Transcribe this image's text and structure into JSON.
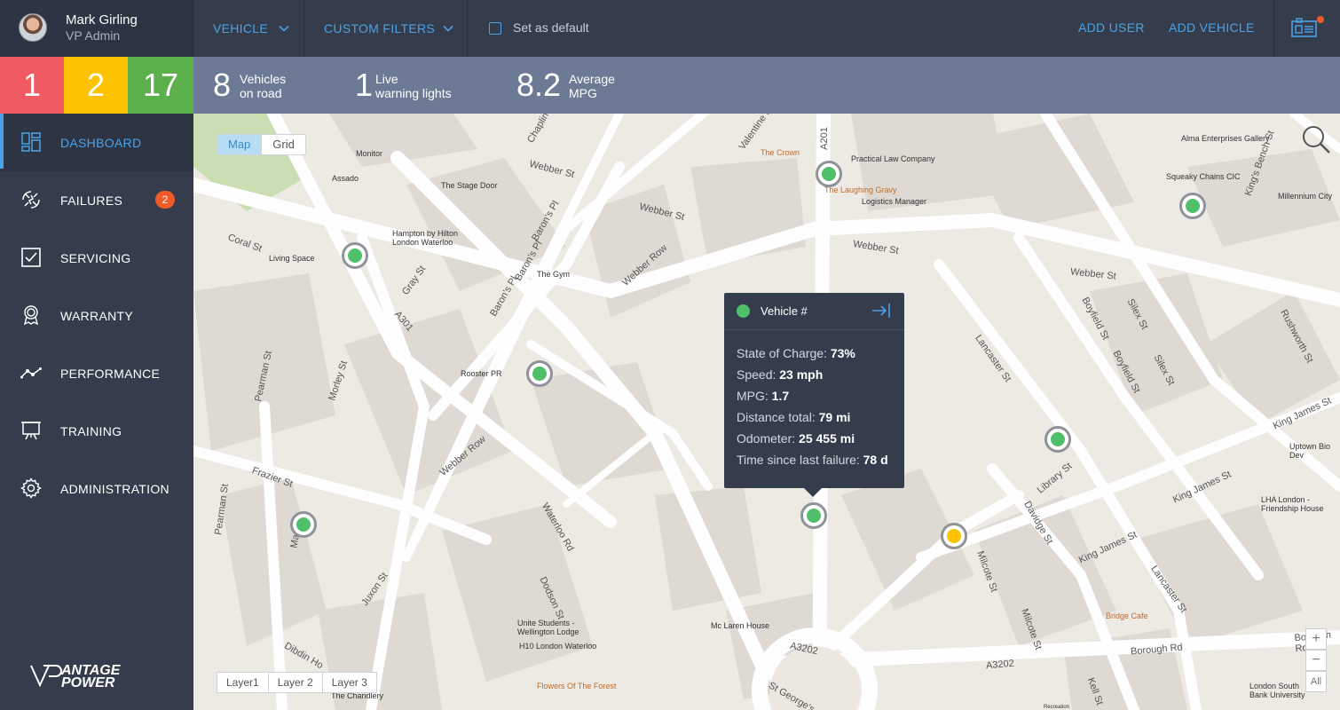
{
  "user": {
    "name": "Mark Girling",
    "role": "VP Admin"
  },
  "toolbar": {
    "vehicle_label": "VEHICLE",
    "custom_filters_label": "CUSTOM FILTERS",
    "set_default_label": "Set as default",
    "set_default_checked": false,
    "add_user_label": "ADD USER",
    "add_vehicle_label": "ADD VEHICLE",
    "notification_icon": "notifications-icon"
  },
  "alerts": {
    "red": "1",
    "yellow": "2",
    "green": "17"
  },
  "stats": [
    {
      "value": "8",
      "line1": "Vehicles",
      "line2": "on road"
    },
    {
      "value": "1",
      "line1": "Live",
      "line2": "warning lights"
    },
    {
      "value": "8.2",
      "line1": "Average",
      "line2": "MPG"
    }
  ],
  "nav": [
    {
      "label": "DASHBOARD",
      "icon": "dashboard-icon",
      "active": true
    },
    {
      "label": "FAILURES",
      "icon": "failures-icon",
      "badge": "2"
    },
    {
      "label": "SERVICING",
      "icon": "checkbox-icon"
    },
    {
      "label": "WARRANTY",
      "icon": "award-icon"
    },
    {
      "label": "PERFORMANCE",
      "icon": "line-chart-icon"
    },
    {
      "label": "TRAINING",
      "icon": "presentation-icon"
    },
    {
      "label": "ADMINISTRATION",
      "icon": "gear-icon"
    }
  ],
  "logo": {
    "text": "VANTAGE POWER"
  },
  "map": {
    "view_toggle": {
      "map": "Map",
      "grid": "Grid",
      "selected": "Map"
    },
    "layers": [
      "Layer1",
      "Layer 2",
      "Layer 3"
    ],
    "zoom": {
      "in": "+",
      "out": "−",
      "all": "All"
    },
    "streets": [
      "Webber St",
      "Webber St",
      "Webber St",
      "Webber St",
      "Webber Row",
      "Webber Row",
      "Waterloo Rd",
      "A301",
      "A201",
      "A3202",
      "A3202",
      "Borough Rd",
      "Borough Rd",
      "Library St",
      "Lancaster St",
      "Lancaster St",
      "King James St",
      "King James St",
      "King James St",
      "Boyfield St",
      "Boyfield St",
      "Silex St",
      "Silex St",
      "Rushworth St",
      "Davidge St",
      "Milcote St",
      "Milcote St",
      "Morley St",
      "Gray St",
      "Pearman St",
      "Pearman St",
      "Baron's Pl",
      "Baron's Pl",
      "Baron's Pl",
      "Coral St",
      "Frazier St",
      "Dodson St",
      "Juxon St",
      "Kell St",
      "Dibdin Ho",
      "Chaplin",
      "Valentine Pl",
      "St George's",
      "King's Bench St",
      "Ma"
    ],
    "places": [
      "Monitor",
      "Assado",
      "The Stage Door",
      "Hampton by Hilton London Waterloo",
      "Living Space",
      "The Gym",
      "Rooster PR",
      "The Crown",
      "Practical Law Company",
      "The Laughing Gravy",
      "Logistics Manager",
      "Alma Enterprises Gallery",
      "Squeaky Chains CIC",
      "Millennium City",
      "Uptown Bio Dev",
      "LHA London - Friendship House",
      "Bridge Cafe",
      "Unite Students - Wellington Lodge",
      "H10 London Waterloo",
      "Mc Laren House",
      "Flowers Of The Forest",
      "The Chandlery",
      "London South Bank University",
      "Recreation"
    ],
    "markers": [
      {
        "status": "ok"
      },
      {
        "status": "ok"
      },
      {
        "status": "ok"
      },
      {
        "status": "ok"
      },
      {
        "status": "ok"
      },
      {
        "status": "ok"
      },
      {
        "status": "ok"
      },
      {
        "status": "warning"
      }
    ]
  },
  "popup": {
    "title": "Vehicle #",
    "open_icon": "open-details-icon",
    "rows": [
      {
        "label": "State of Charge:",
        "value": "73%"
      },
      {
        "label": "Speed:",
        "value": "23 mph"
      },
      {
        "label": "MPG:",
        "value": "1.7"
      },
      {
        "label": "Distance total:",
        "value": "79 mi"
      },
      {
        "label": "Odometer:",
        "value": "25 455 mi"
      },
      {
        "label": "Time since last failure:",
        "value": "78 d"
      }
    ]
  },
  "colors": {
    "alert_red": "#f05a62",
    "alert_yellow": "#fdc300",
    "alert_green": "#5bb04b",
    "accent": "#4aa3e8",
    "marker_ok": "#4fbf6a",
    "marker_warning": "#fdc300"
  }
}
